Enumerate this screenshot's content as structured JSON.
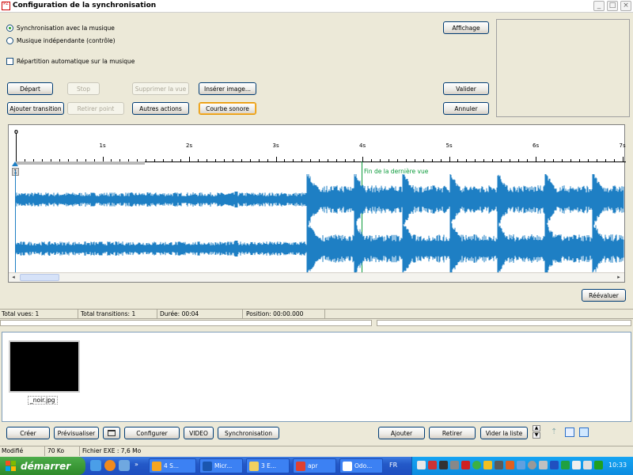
{
  "window": {
    "title": "Configuration de la synchronisation",
    "icon_text": "PZ",
    "controls": [
      "_",
      "□",
      "×"
    ]
  },
  "options": {
    "radio1_label": "Synchronisation avec la musique",
    "radio1_checked": true,
    "radio2_label": "Musique indépendante (contrôle)",
    "radio2_checked": false,
    "checkbox_label": "Répartition automatique sur la musique",
    "checkbox_checked": false
  },
  "buttons": {
    "affichage": "Affichage",
    "depart": "Départ",
    "stop": "Stop",
    "supprimer_vue": "Supprimer la vue",
    "inserer_image": "Insérer image...",
    "valider": "Valider",
    "ajouter_transition": "Ajouter transition",
    "retirer_point": "Retirer point",
    "autres_actions": "Autres actions",
    "courbe_sonore": "Courbe sonore",
    "annuler": "Annuler",
    "reevaluer": "Réévaluer"
  },
  "timeline": {
    "start_label": "0",
    "ticks": [
      "1s",
      "2s",
      "3s",
      "4s",
      "5s",
      "6s",
      "7s"
    ],
    "marker_number": "1",
    "end_marker_label": "Fin de la dernière vue",
    "waveform_color": "#1e7fc4",
    "cursor_color": "#0a9a3a"
  },
  "status": {
    "total_vues": "Total vues: 1",
    "total_transitions": "Total transitions: 1",
    "duree": "Durée: 00:04",
    "position": "Position: 00:00.000"
  },
  "thumbnail": {
    "label": "_noir.jpg"
  },
  "bottom_buttons": {
    "creer": "Créer",
    "previsualiser": "Prévisualiser",
    "configurer": "Configurer",
    "video": "VIDEO",
    "synchronisation": "Synchronisation",
    "ajouter": "Ajouter",
    "retirer": "Retirer",
    "vider_liste": "Vider la liste"
  },
  "statusbar": {
    "state": "Modifié",
    "size": "70 Ko",
    "file": "Fichier EXE : 7,6 Mo"
  },
  "taskbar": {
    "start_label": "démarrer",
    "tasks": [
      "4 S...",
      "Micr...",
      "3 E...",
      "apr",
      "Odo..."
    ],
    "language": "FR",
    "clock": "10:33"
  },
  "colors": {
    "accent": "#003c74",
    "taskbar": "#2459c8",
    "start": "#3c9a38",
    "tray": "#0d8ce0"
  }
}
